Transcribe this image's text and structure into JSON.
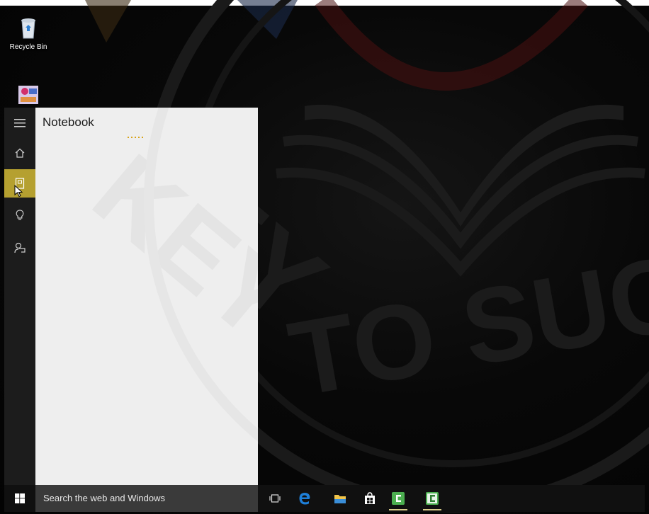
{
  "desktop": {
    "icons": [
      {
        "label": "Recycle Bin",
        "icon": "recycle-bin-icon"
      },
      {
        "label": "",
        "icon": "shortcut-icon"
      }
    ],
    "watermark_text": [
      "KEY",
      "TO SUCC"
    ]
  },
  "cortana": {
    "rail": {
      "items": [
        {
          "icon": "hamburger-menu-icon",
          "active": false
        },
        {
          "icon": "home-icon",
          "active": false
        },
        {
          "icon": "notebook-icon",
          "active": true
        },
        {
          "icon": "lightbulb-icon",
          "active": false
        },
        {
          "icon": "feedback-icon",
          "active": false
        }
      ]
    },
    "panel": {
      "title": "Notebook",
      "loading": true
    }
  },
  "taskbar": {
    "start_icon": "windows-logo-icon",
    "search_placeholder": "Search the web and Windows",
    "apps": [
      {
        "icon": "task-view-icon",
        "running": false
      },
      {
        "icon": "edge-icon",
        "running": false
      },
      {
        "icon": "file-explorer-icon",
        "running": false
      },
      {
        "icon": "store-icon",
        "running": false
      },
      {
        "icon": "camtasia-icon",
        "running": true
      },
      {
        "icon": "camtasia-icon",
        "running": true
      }
    ]
  },
  "colors": {
    "accent": "#b5a030",
    "panel_bg": "#eeeeee",
    "rail_bg": "#1c1c1c",
    "taskbar_bg": "#101010",
    "search_bg": "#3a3a3a",
    "loading_dots": "#d8a31a",
    "edge_blue": "#1e7fd8",
    "camtasia_green": "#4caf50"
  }
}
